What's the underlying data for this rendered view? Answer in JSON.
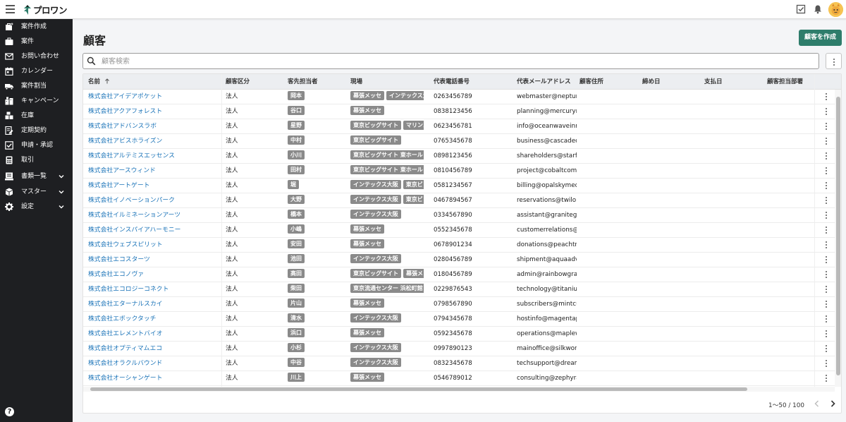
{
  "app": {
    "logo_text": "プロワン"
  },
  "sidebar": {
    "items": [
      {
        "label": "案件作成",
        "icon": "new-case-icon"
      },
      {
        "label": "案件",
        "icon": "briefcase-icon"
      },
      {
        "label": "お問い合わせ",
        "icon": "mail-icon"
      },
      {
        "label": "カレンダー",
        "icon": "calendar-icon"
      },
      {
        "label": "案件割当",
        "icon": "truck-icon"
      },
      {
        "label": "キャンペーン",
        "icon": "campaign-icon"
      },
      {
        "label": "在庫",
        "icon": "warehouse-icon"
      },
      {
        "label": "定期契約",
        "icon": "contract-icon"
      },
      {
        "label": "申請・承認",
        "icon": "checkbox-icon"
      },
      {
        "label": "取引",
        "icon": "calculator-icon"
      },
      {
        "label": "書類一覧",
        "icon": "document-icon",
        "expandable": true
      },
      {
        "label": "マスター",
        "icon": "master-icon",
        "expandable": true
      },
      {
        "label": "設定",
        "icon": "gear-icon",
        "expandable": true
      }
    ],
    "help": "?"
  },
  "main": {
    "title": "顧客",
    "create_button": "顧客を作成",
    "search_placeholder": "顧客検索"
  },
  "table": {
    "columns": [
      "名前",
      "顧客区分",
      "客先担当者",
      "現場",
      "代表電話番号",
      "代表メールアドレス",
      "顧客住所",
      "締め日",
      "支払日",
      "顧客担当部署"
    ],
    "sort_column": "名前",
    "sort_direction": "ascending",
    "rows": [
      {
        "name": "株式会社アイデアポケット",
        "type": "法人",
        "contact": "岡本",
        "sites": [
          "幕張メッセ",
          "インテックス大阪"
        ],
        "phone": "0263456789",
        "email": "webmaster@neptune"
      },
      {
        "name": "株式会社アクアフォレスト",
        "type": "法人",
        "contact": "谷口",
        "sites": [
          "幕張メッセ"
        ],
        "phone": "0838123456",
        "email": "planning@mercurym"
      },
      {
        "name": "株式会社アドバンスラボ",
        "type": "法人",
        "contact": "星野",
        "sites": [
          "東京ビッグサイト",
          "マリンメッセ"
        ],
        "phone": "0623456781",
        "email": "info@oceanwaveinno"
      },
      {
        "name": "株式会社アビスホライズン",
        "type": "法人",
        "contact": "中村",
        "sites": [
          "東京ビッグサイト"
        ],
        "phone": "0765345678",
        "email": "business@cascadecol"
      },
      {
        "name": "株式会社アルテミスエッセンス",
        "type": "法人",
        "contact": "小川",
        "sites": [
          "東京ビッグサイト 東ホール"
        ],
        "phone": "0898123456",
        "email": "shareholders@starfire"
      },
      {
        "name": "株式会社アースウィンド",
        "type": "法人",
        "contact": "田村",
        "sites": [
          "東京ビッグサイト 東ホール"
        ],
        "phone": "0810456789",
        "email": "project@cobaltcompu"
      },
      {
        "name": "株式会社アートゲート",
        "type": "法人",
        "contact": "堀",
        "sites": [
          "インテックス大阪",
          "東京ビッグサイト"
        ],
        "phone": "0581234567",
        "email": "billing@opalskymedia"
      },
      {
        "name": "株式会社イノベーションパーク",
        "type": "法人",
        "contact": "大野",
        "sites": [
          "インテックス大阪",
          "東京ビッグサイト"
        ],
        "phone": "0467894567",
        "email": "reservations@twilora"
      },
      {
        "name": "株式会社イルミネーションアーツ",
        "type": "法人",
        "contact": "橋本",
        "sites": [
          "インテックス大阪"
        ],
        "phone": "0334567890",
        "email": "assistant@granitegam"
      },
      {
        "name": "株式会社インスパイアハーモニー",
        "type": "法人",
        "contact": "小嶋",
        "sites": [
          "幕張メッセ"
        ],
        "phone": "0552345678",
        "email": "customerrelations@c"
      },
      {
        "name": "株式会社ウェブスピリット",
        "type": "法人",
        "contact": "安田",
        "sites": [
          "幕張メッセ"
        ],
        "phone": "0678901234",
        "email": "donations@peachtree"
      },
      {
        "name": "株式会社エコスターツ",
        "type": "法人",
        "contact": "池田",
        "sites": [
          "インテックス大阪"
        ],
        "phone": "0280456789",
        "email": "shipment@aquaadve"
      },
      {
        "name": "株式会社エコノヴァ",
        "type": "法人",
        "contact": "高田",
        "sites": [
          "東京ビッグサイト",
          "幕張メッセ"
        ],
        "phone": "0180456789",
        "email": "admin@rainbowgraph"
      },
      {
        "name": "株式会社エコロジーコネクト",
        "type": "法人",
        "contact": "柴田",
        "sites": [
          "東京流通センター 浜松町館"
        ],
        "phone": "0229876543",
        "email": "technology@titanium"
      },
      {
        "name": "株式会社エターナルスカイ",
        "type": "法人",
        "contact": "片山",
        "sites": [
          "幕張メッセ"
        ],
        "phone": "0798567890",
        "email": "subscribers@mintcui"
      },
      {
        "name": "株式会社エボックタッチ",
        "type": "法人",
        "contact": "清水",
        "sites": [
          "インテックス大阪"
        ],
        "phone": "0794345678",
        "email": "hostinfo@magentapla"
      },
      {
        "name": "株式会社エレメントバイオ",
        "type": "法人",
        "contact": "浜口",
        "sites": [
          "幕張メッセ"
        ],
        "phone": "0592345678",
        "email": "operations@maplewo"
      },
      {
        "name": "株式会社オプティマムエコ",
        "type": "法人",
        "contact": "小杉",
        "sites": [
          "インテックス大阪"
        ],
        "phone": "0997890123",
        "email": "mainoffice@silkworm"
      },
      {
        "name": "株式会社オラクルバウンド",
        "type": "法人",
        "contact": "中谷",
        "sites": [
          "インテックス大阪"
        ],
        "phone": "0832345678",
        "email": "techsupport@dreamv"
      },
      {
        "name": "株式会社オーシャンゲート",
        "type": "法人",
        "contact": "川上",
        "sites": [
          "幕張メッセ"
        ],
        "phone": "0546789012",
        "email": "consulting@zephyrai"
      }
    ]
  },
  "pagination": {
    "range_text": "1〜50 / 100"
  },
  "colors": {
    "accent": "#2e7d6b",
    "link": "#1a73b8",
    "sidebar_bg": "#1e1f22",
    "chip_bg": "#8a8a8a"
  }
}
